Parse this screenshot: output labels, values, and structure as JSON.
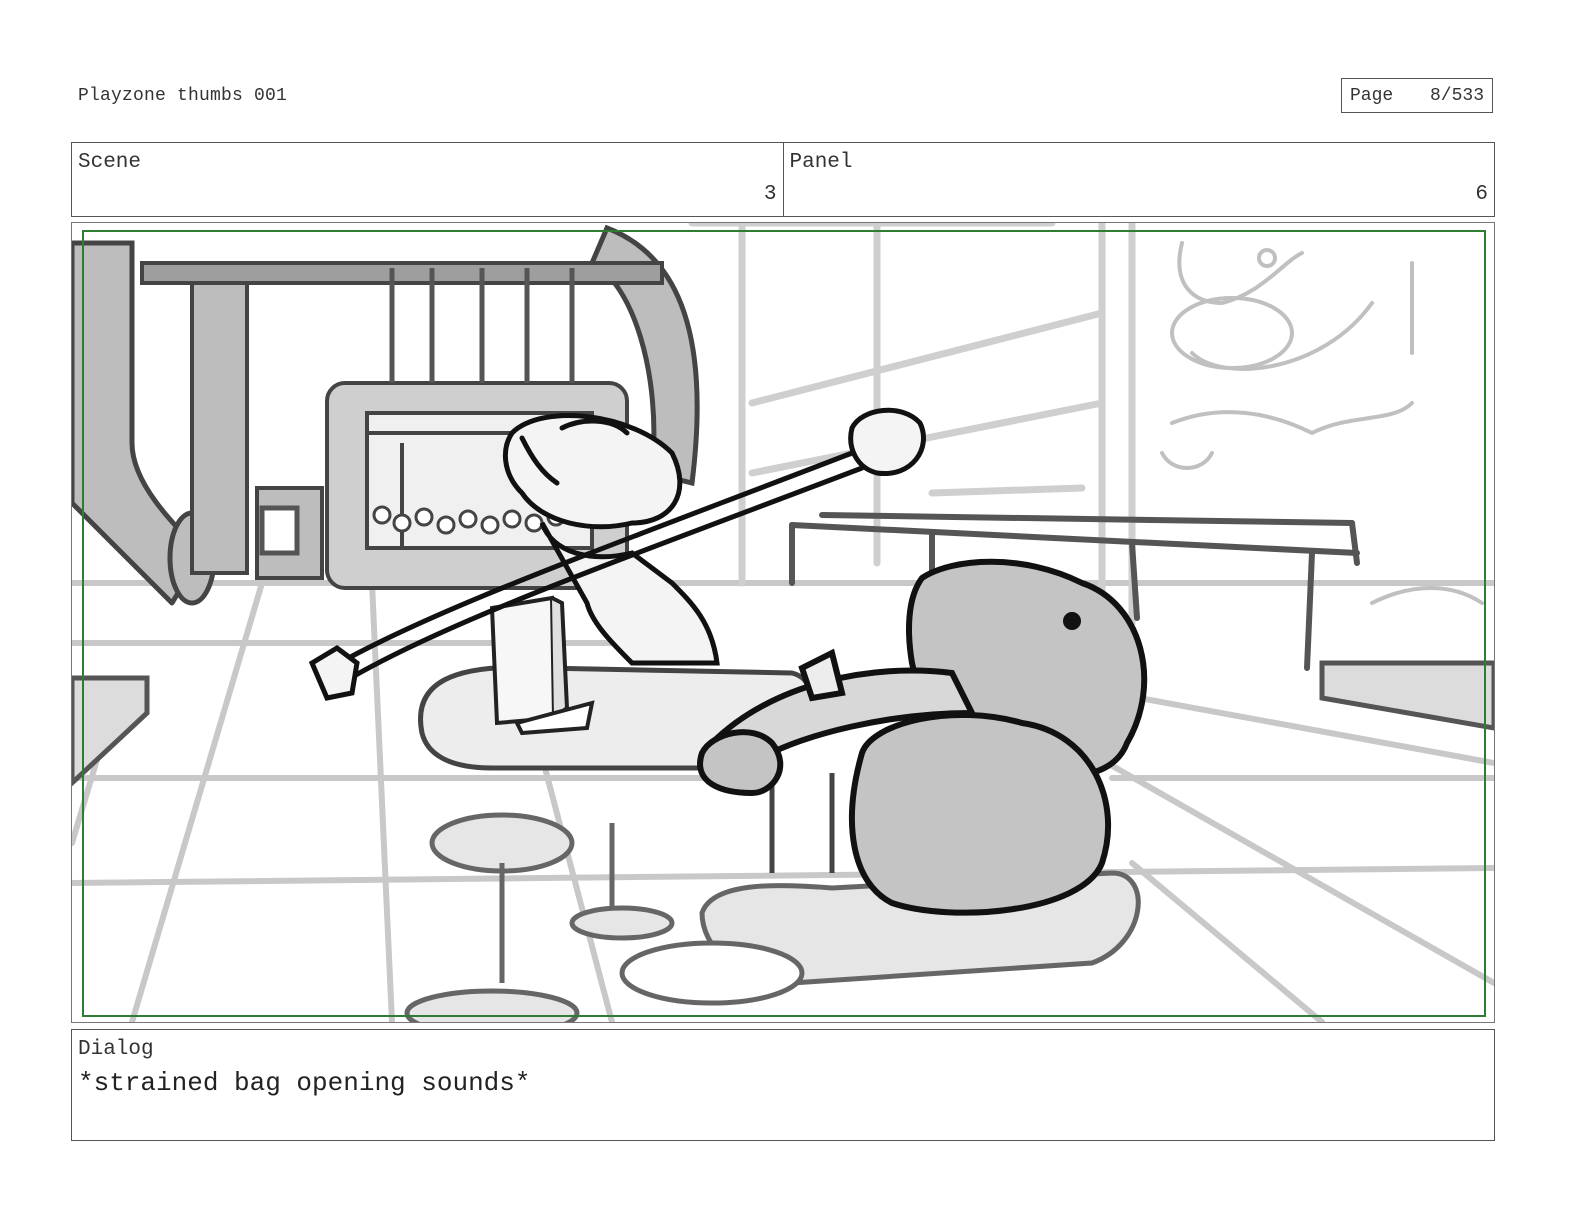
{
  "document": {
    "title": "Playzone thumbs 001",
    "page_label": "Page",
    "page_value": "8/533"
  },
  "header": {
    "scene_label": "Scene",
    "scene_value": "3",
    "panel_label": "Panel",
    "panel_value": "6"
  },
  "frame": {
    "image": "storyboard-sketch: two characters at a play-area table, one stretching open a snack bag; tube slide and ball pit in background",
    "safe_area_color": "#2e7d32"
  },
  "dialog": {
    "label": "Dialog",
    "text": "*strained bag opening sounds*"
  }
}
